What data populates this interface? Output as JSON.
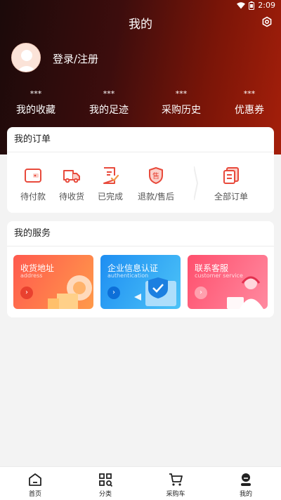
{
  "status": {
    "time": "2:09"
  },
  "header": {
    "title": "我的"
  },
  "user": {
    "login_text": "登录/注册"
  },
  "stats": [
    {
      "value": "***",
      "label": "我的收藏"
    },
    {
      "value": "***",
      "label": "我的足迹"
    },
    {
      "value": "***",
      "label": "采购历史"
    },
    {
      "value": "***",
      "label": "优惠券"
    }
  ],
  "orders": {
    "title": "我的订单",
    "items": [
      {
        "label": "待付款",
        "icon": "wallet-icon"
      },
      {
        "label": "待收货",
        "icon": "truck-icon"
      },
      {
        "label": "已完成",
        "icon": "receipt-check-icon"
      },
      {
        "label": "退款/售后",
        "icon": "after-sale-shield-icon"
      },
      {
        "label": "全部订单",
        "icon": "documents-icon"
      }
    ],
    "refund_badge_char": "售"
  },
  "services": {
    "title": "我的服务",
    "items": [
      {
        "title": "收货地址",
        "subtitle": "address"
      },
      {
        "title": "企业信息认证",
        "subtitle": "authentication"
      },
      {
        "title": "联系客服",
        "subtitle": "customer service"
      }
    ],
    "arrow": "›"
  },
  "tabbar": [
    {
      "label": "首页",
      "icon": "home-icon"
    },
    {
      "label": "分类",
      "icon": "category-icon"
    },
    {
      "label": "采购车",
      "icon": "cart-icon"
    },
    {
      "label": "我的",
      "icon": "profile-icon"
    }
  ],
  "colors": {
    "accent": "#e84a3c",
    "header_dark": "#1b0a0a",
    "header_red": "#a51f0a",
    "address_card": "#ff6d4a",
    "auth_card": "#2aa6f5",
    "service_card": "#ff6a82"
  }
}
